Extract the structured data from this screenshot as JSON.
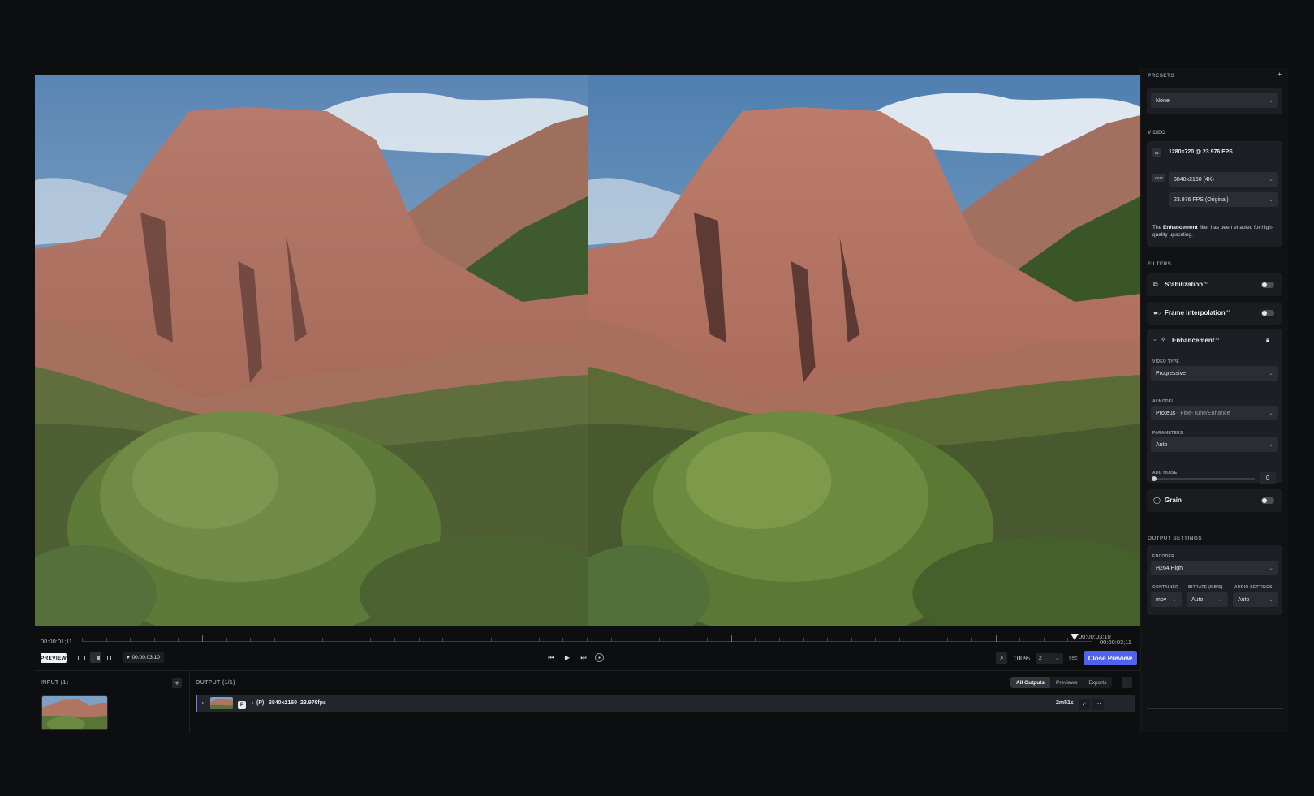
{
  "timeline": {
    "start_time": "00:00:01;11",
    "playhead_time": "00:00:03;10",
    "end_time": "00:00:03;11",
    "preview_badge": "PREVIEW",
    "current_time": "00:00:03;10",
    "zoom_value": "100%",
    "seconds_value": "2",
    "seconds_unit": "sec",
    "close_preview_label": "Close Preview"
  },
  "input": {
    "label": "INPUT (1)"
  },
  "output": {
    "label": "OUTPUT (1/1)",
    "tabs": [
      "All Outputs",
      "Previews",
      "Exports"
    ],
    "active_tab": "All Outputs",
    "row": {
      "badge": "P",
      "model_tag": "(P)",
      "resolution": "3840x2160",
      "fps": "23.976fps",
      "duration": "2m51s"
    }
  },
  "sidebar": {
    "presets_label": "PRESETS",
    "preset_value": "None",
    "video_label": "VIDEO",
    "in_tag": "IN",
    "in_value": "1280x720 @ 23.976 FPS",
    "out_tag": "OUT",
    "out_resolution": "3840x2160 (4K)",
    "out_fps": "23.976 FPS (Original)",
    "note_prefix": "The ",
    "note_bold": "Enhancement",
    "note_suffix": " filter has been enabled for high-quality upscaling.",
    "filters_label": "FILTERS",
    "stabilization_label": "Stabilization",
    "frame_interp_label": "Frame Interpolation",
    "enhancement_label": "Enhancement",
    "ai_sup": "AI",
    "video_type_label": "VIDEO TYPE",
    "video_type_value": "Progressive",
    "ai_model_label": "AI MODEL",
    "ai_model_value": "Proteus",
    "ai_model_sub": " - Fine-Tune/Enhance",
    "parameters_label": "PARAMETERS",
    "parameters_value": "Auto",
    "add_noise_label": "ADD NOISE",
    "add_noise_value": "0",
    "grain_label": "Grain",
    "output_settings_label": "OUTPUT SETTINGS",
    "encoder_label": "ENCODER",
    "encoder_value": "H264 High",
    "container_label": "CONTAINER",
    "container_value": "mov",
    "bitrate_label": "BITRATE (MB/S)",
    "bitrate_value": "Auto",
    "audio_label": "AUDIO SETTINGS",
    "audio_value": "Auto"
  }
}
